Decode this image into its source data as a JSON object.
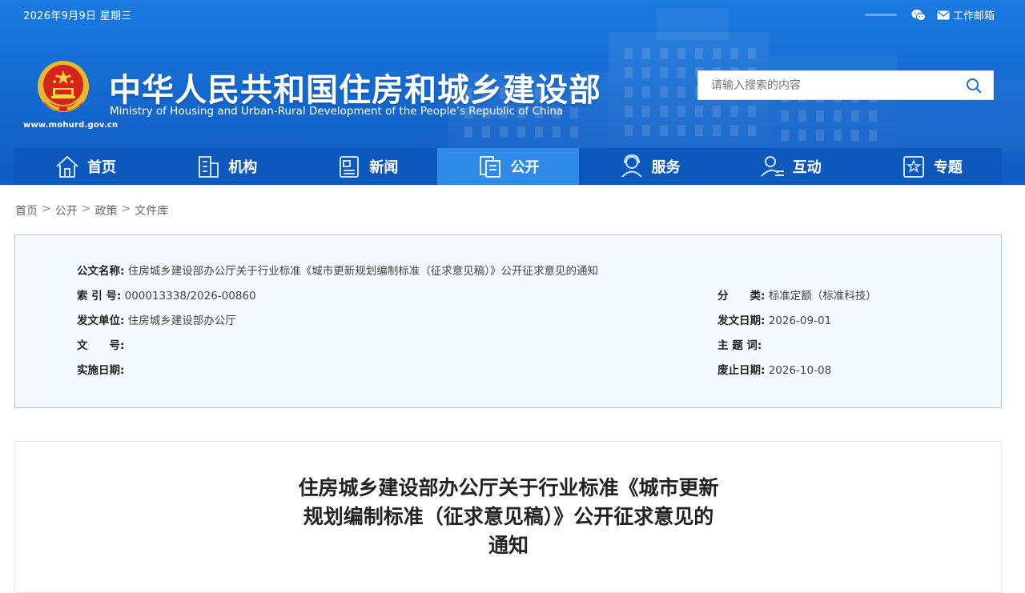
{
  "header": {
    "date": "2026年9月9日 星期三",
    "mail_label": "工作邮箱",
    "title_cn": "中华人民共和国住房和城乡建设部",
    "title_en": "Ministry of Housing and Urban-Rural Development of the People’s Republic of China",
    "site_url": "www.mohurd.gov.cn",
    "search_placeholder": "请输入搜索的内容",
    "icons": {
      "wechat": "wechat-icon",
      "mail": "mail-icon",
      "search": "search-icon",
      "emblem": "national-emblem"
    }
  },
  "nav": {
    "items": [
      {
        "label": "首页",
        "icon": "home-icon"
      },
      {
        "label": "机构",
        "icon": "building-icon"
      },
      {
        "label": "新闻",
        "icon": "news-icon"
      },
      {
        "label": "公开",
        "icon": "document-icon",
        "active": true
      },
      {
        "label": "服务",
        "icon": "service-icon"
      },
      {
        "label": "互动",
        "icon": "interact-icon"
      },
      {
        "label": "专题",
        "icon": "topic-icon"
      }
    ]
  },
  "breadcrumb": [
    "首页",
    "公开",
    "政策",
    "文件库"
  ],
  "breadcrumb_separator": ">",
  "meta": {
    "title_label": "公文名称:",
    "title_value": "住房城乡建设部办公厅关于行业标准《城市更新规划编制标准（征求意见稿）》公开征求意见的通知",
    "index_label": "索 引 号:",
    "index_value": "000013338/2026-00860",
    "category_label": "分　　类:",
    "category_value": "标准定额（标准科技）",
    "issuer_label": "发文单位:",
    "issuer_value": "住房城乡建设部办公厅",
    "issue_date_label": "发文日期:",
    "issue_date_value": "2026-09-01",
    "doc_no_label": "文　　号:",
    "doc_no_value": "",
    "keywords_label": "主 题 词:",
    "keywords_value": "",
    "effective_label": "实施日期:",
    "effective_value": "",
    "expire_label": "废止日期:",
    "expire_value": "2026-10-08"
  },
  "article": {
    "title_line1": "住房城乡建设部办公厅关于行业标准《城市更新",
    "title_line2": "规划编制标准（征求意见稿）》公开征求意见的",
    "title_line3": "通知"
  },
  "colors": {
    "header_blue": "#1468cf",
    "nav_blue": "#0d58bd",
    "nav_active": "#2f8ae8",
    "meta_bg": "#f4f9fe",
    "meta_border": "#a9cbe8"
  }
}
